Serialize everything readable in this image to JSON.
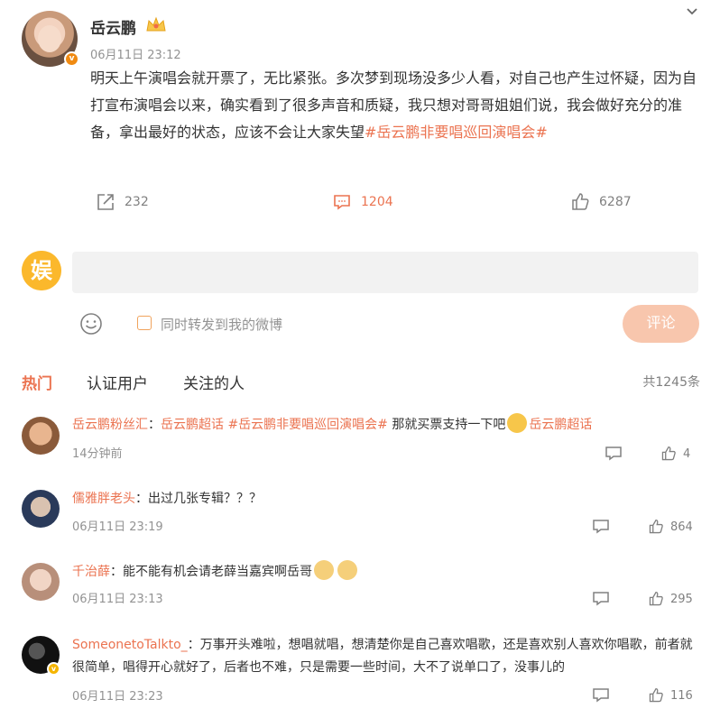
{
  "post": {
    "author": "岳云鹏",
    "time": "06月11日 23:12",
    "text": "明天上午演唱会就开票了，无比紧张。多次梦到现场没多少人看，对自己也产生过怀疑，因为自打宣布演唱会以来，确实看到了很多声音和质疑，我只想对哥哥姐姐们说，我会做好充分的准备，拿出最好的状态，应该不会让大家失望",
    "topic": "#岳云鹏非要唱巡回演唱会#",
    "share_count": "232",
    "comment_count": "1204",
    "like_count": "6287",
    "verified_badge": "v"
  },
  "composer": {
    "placeholder": "",
    "repost_label": "同时转发到我的微博",
    "submit_label": "评论"
  },
  "tabs": [
    {
      "label": "热门"
    },
    {
      "label": "认证用户"
    },
    {
      "label": "关注的人"
    }
  ],
  "total_comments": "共1245条",
  "comments": [
    {
      "user": "岳云鹏粉丝汇",
      "sep": "：",
      "parts": [
        "岳云鹏超话",
        " ",
        "#岳云鹏非要唱巡回演唱会#",
        " 那就买票支持一下吧",
        "岳云鹏超话"
      ],
      "time": "14分钟前",
      "likes": "4"
    },
    {
      "user": "儒雅胖老头",
      "sep": "：",
      "text": "出过几张专辑？？？",
      "time": "06月11日 23:19",
      "likes": "864"
    },
    {
      "user": "千治薛",
      "sep": "：",
      "text": "能不能有机会请老薛当嘉宾啊岳哥",
      "time": "06月11日 23:13",
      "likes": "295"
    },
    {
      "user": "SomeonetoTalkto_",
      "sep": "：",
      "text": "万事开头难啦，想唱就唱，想清楚你是自己喜欢唱歌，还是喜欢别人喜欢你唱歌，前者就很简单，唱得开心就好了，后者也不难，只是需要一些时间，大不了说单口了，没事儿的",
      "time": "06月11日 23:23",
      "likes": "116"
    }
  ],
  "colors": {
    "accent": "#eb7350",
    "muted": "#939393",
    "submit_bg": "#f8c6ad"
  }
}
